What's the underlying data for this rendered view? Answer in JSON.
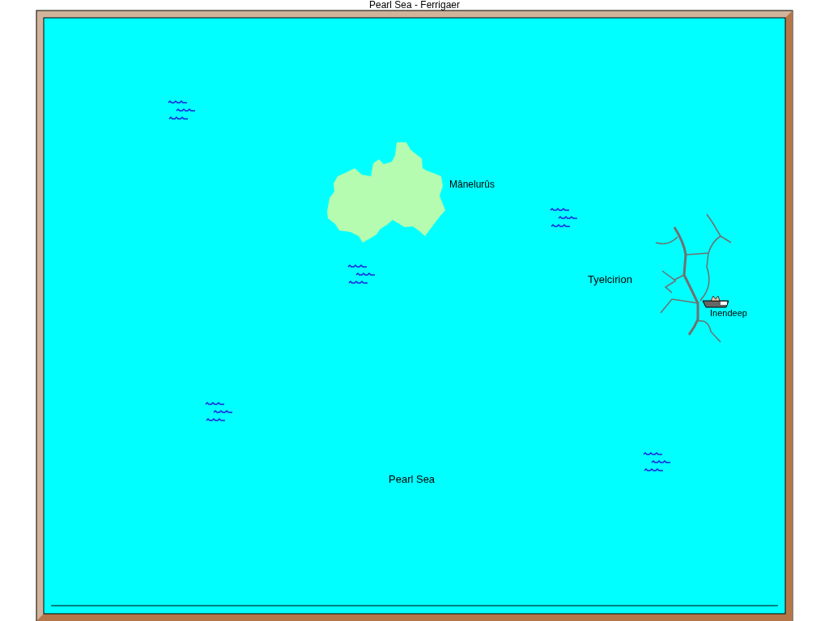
{
  "window": {
    "title": "Pearl Sea - Ferrigaer"
  },
  "map": {
    "labels": [
      {
        "text": "Mânelurûs",
        "kind": "island"
      },
      {
        "text": "Tyelcirion",
        "kind": "region"
      },
      {
        "text": "Inendeep",
        "kind": "town"
      },
      {
        "text": "Pearl Sea",
        "kind": "sea"
      }
    ]
  }
}
